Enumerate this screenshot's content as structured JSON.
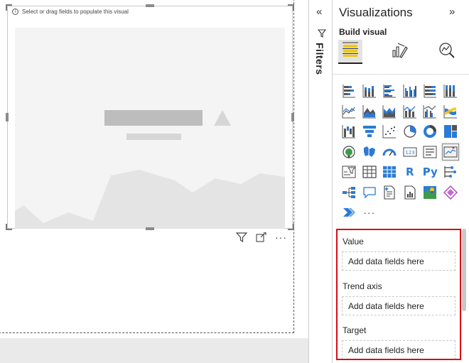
{
  "canvas": {
    "visual_hint": "Select or drag fields to populate this visual"
  },
  "filters": {
    "label": "Filters",
    "collapse_icon": "double-chevron-left-icon",
    "funnel_icon": "filter-icon"
  },
  "pane": {
    "title": "Visualizations",
    "collapse_icon": "double-chevron-right-icon",
    "build_label": "Build visual",
    "mode_tabs": [
      {
        "icon": "build-visual-icon",
        "active": true
      },
      {
        "icon": "format-visual-icon",
        "active": false
      },
      {
        "icon": "analytics-icon",
        "active": false
      }
    ],
    "visual_icons": [
      [
        "stacked-bar-chart-icon",
        "stacked-column-chart-icon",
        "clustered-bar-chart-icon",
        "clustered-column-chart-icon",
        "100-percent-stacked-bar-chart-icon",
        "100-percent-stacked-column-chart-icon"
      ],
      [
        "line-chart-icon",
        "area-chart-icon",
        "stacked-area-chart-icon",
        "line-and-stacked-column-chart-icon",
        "line-and-clustered-column-chart-icon",
        "ribbon-chart-icon"
      ],
      [
        "waterfall-chart-icon",
        "funnel-icon",
        "scatter-chart-icon",
        "pie-chart-icon",
        "donut-chart-icon",
        "treemap-icon"
      ],
      [
        "map-icon",
        "filled-map-icon",
        "gauge-icon",
        "card-icon",
        "multi-row-card-icon",
        "kpi-icon"
      ],
      [
        "slicer-icon",
        "table-icon",
        "matrix-icon",
        "r-script-visual-icon",
        "python-visual-icon",
        "key-influencers-icon"
      ],
      [
        "decomposition-tree-icon",
        "q-and-a-icon",
        "smart-narrative-icon",
        "paginated-report-icon",
        "azure-map-icon",
        "power-apps-icon"
      ],
      [
        "power-automate-icon",
        "more-visuals-icon"
      ]
    ],
    "r_label": "R",
    "py_label": "Py",
    "more_label": "···",
    "selected_visual": "kpi-icon"
  },
  "wells": [
    {
      "title": "Value",
      "placeholder": "Add data fields here"
    },
    {
      "title": "Trend axis",
      "placeholder": "Add data fields here"
    },
    {
      "title": "Target",
      "placeholder": "Add data fields here"
    }
  ],
  "colors": {
    "accent_blue": "#2b7bd6",
    "highlight_red": "#d80c14",
    "kpi_yellow": "#f2c811"
  }
}
